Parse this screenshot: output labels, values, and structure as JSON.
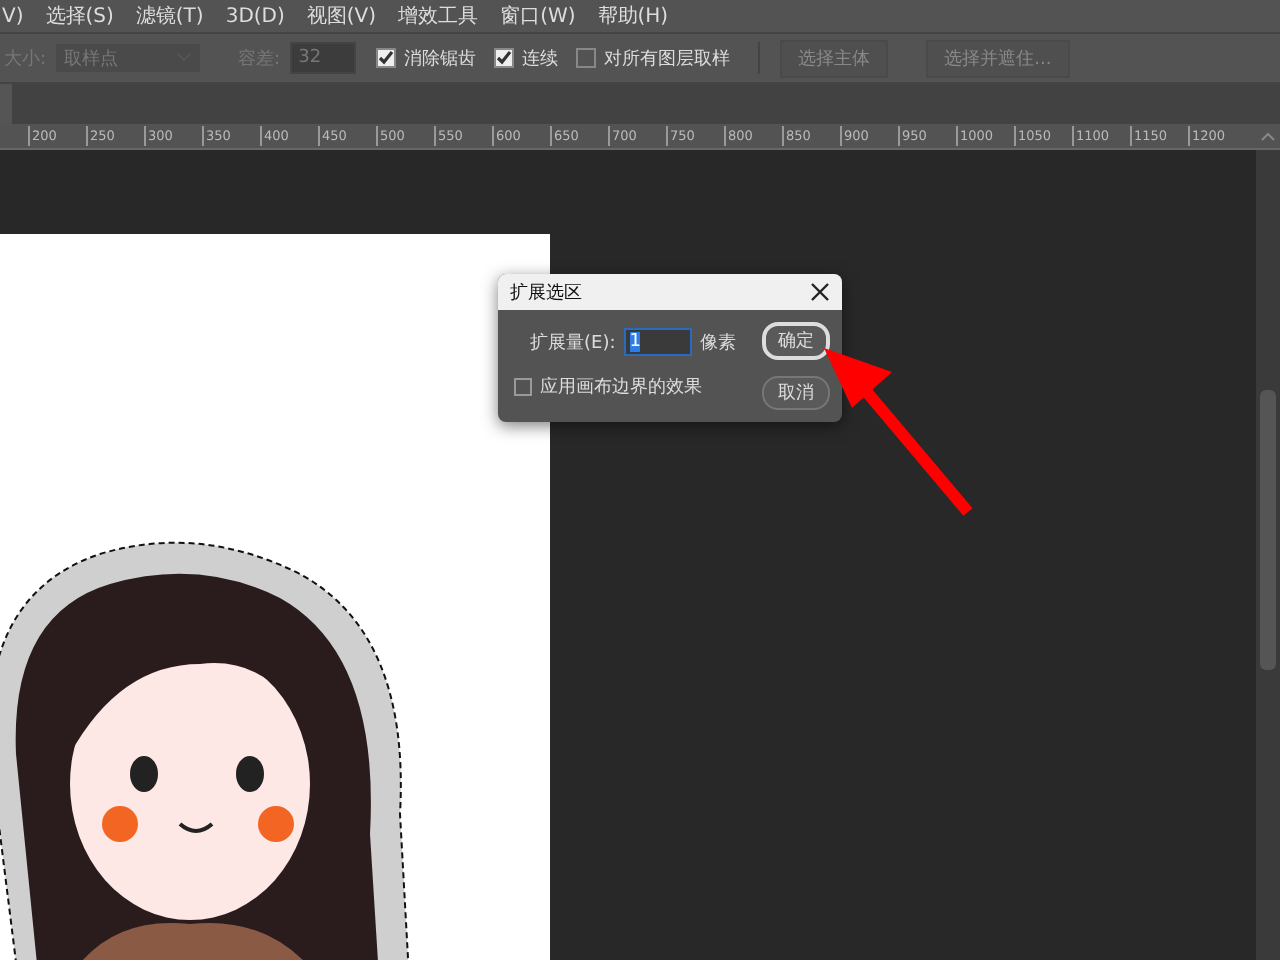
{
  "menu": [
    {
      "label": "V)"
    },
    {
      "label": "选择(S)"
    },
    {
      "label": "滤镜(T)"
    },
    {
      "label": "3D(D)"
    },
    {
      "label": "视图(V)"
    },
    {
      "label": "增效工具"
    },
    {
      "label": "窗口(W)"
    },
    {
      "label": "帮助(H)"
    }
  ],
  "options_bar": {
    "size_label": "大小:",
    "size_value": "取样点",
    "tolerance_label": "容差:",
    "tolerance_value": "32",
    "checkboxes": [
      {
        "label": "消除锯齿",
        "checked": true
      },
      {
        "label": "连续",
        "checked": true
      },
      {
        "label": "对所有图层取样",
        "checked": false
      }
    ],
    "buttons": [
      "选择主体",
      "选择并遮住..."
    ]
  },
  "ruler": {
    "ticks": [
      "200",
      "250",
      "300",
      "350",
      "400",
      "450",
      "500",
      "550",
      "600",
      "650",
      "700",
      "750",
      "800",
      "850",
      "900",
      "950",
      "1000",
      "1050",
      "1100",
      "1150",
      "1200"
    ]
  },
  "dialog": {
    "title": "扩展选区",
    "amount_label": "扩展量(E):",
    "amount_value": "1",
    "unit": "像素",
    "checkbox": {
      "label": "应用画布边界的效果",
      "checked": false
    },
    "buttons": [
      {
        "label": "确定",
        "selected": true
      },
      {
        "label": "取消",
        "selected": false
      }
    ]
  }
}
